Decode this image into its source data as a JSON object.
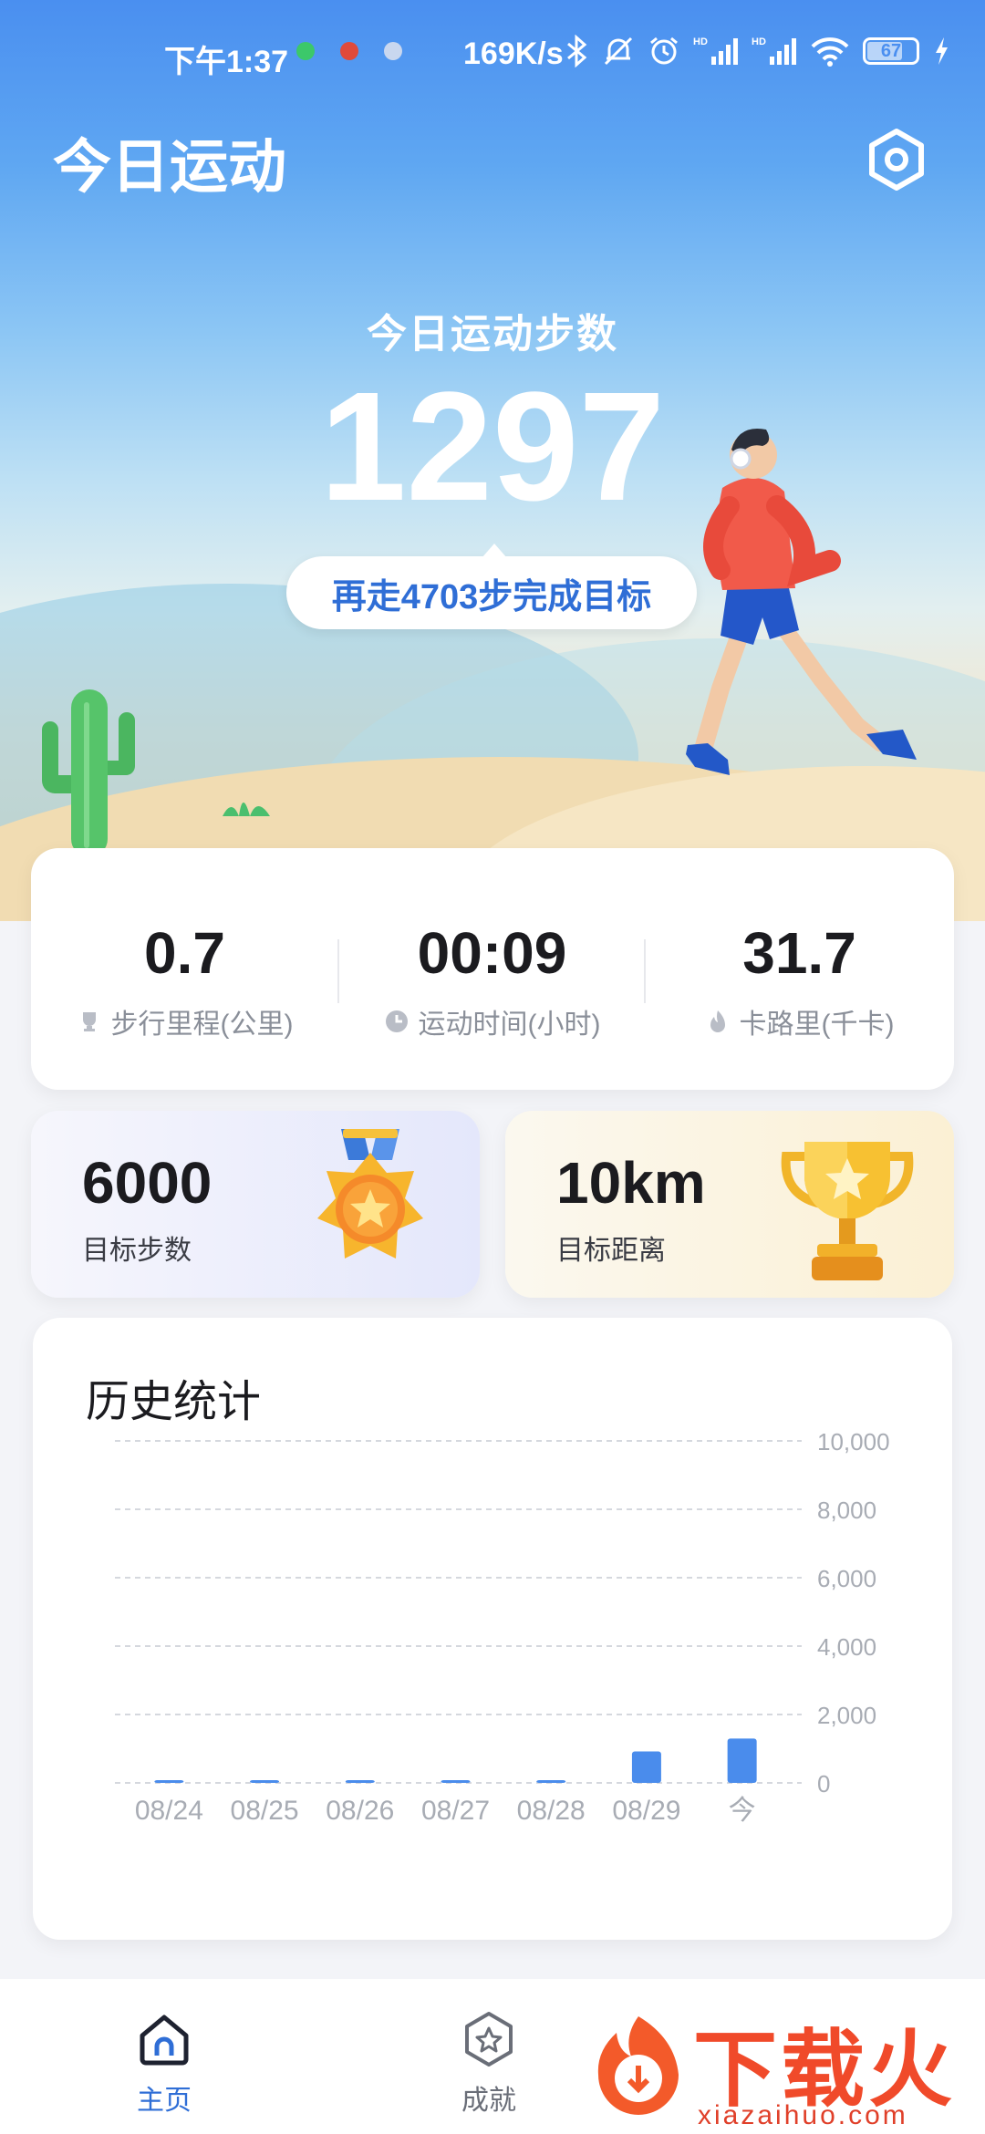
{
  "status_bar": {
    "time": "下午1:37",
    "network_speed": "169K/s",
    "battery": "67",
    "icons": [
      "bluetooth-icon",
      "mute-icon",
      "alarm-icon",
      "signal-icon",
      "signal-icon",
      "wifi-icon",
      "battery-icon",
      "charging-icon"
    ]
  },
  "header": {
    "title": "今日运动",
    "settings_icon": "hexagon-settings-icon"
  },
  "today": {
    "label": "今日运动步数",
    "steps": "1297",
    "goal_hint": "再走4703步完成目标"
  },
  "stats": [
    {
      "value": "0.7",
      "label": "步行里程(公里)",
      "icon": "trophy-icon"
    },
    {
      "value": "00:09",
      "label": "运动时间(小时)",
      "icon": "clock-icon"
    },
    {
      "value": "31.7",
      "label": "卡路里(千卡)",
      "icon": "flame-icon"
    }
  ],
  "goals": {
    "steps": {
      "value": "6000",
      "label": "目标步数"
    },
    "distance": {
      "value": "10km",
      "label": "目标距离"
    }
  },
  "history": {
    "title": "历史统计"
  },
  "chart_data": {
    "type": "bar",
    "title": "历史统计",
    "categories": [
      "08/24",
      "08/25",
      "08/26",
      "08/27",
      "08/28",
      "08/29",
      "今"
    ],
    "values": [
      80,
      80,
      80,
      80,
      80,
      920,
      1297
    ],
    "ylim": [
      0,
      10000
    ],
    "yticks": [
      "10,000",
      "8,000",
      "6,000",
      "4,000",
      "2,000",
      "0"
    ],
    "ytick_values": [
      10000,
      8000,
      6000,
      4000,
      2000,
      0
    ],
    "y_axis_side": "right",
    "grid": true,
    "bar_color": "#4a8cec"
  },
  "nav": {
    "items": [
      {
        "label": "主页",
        "icon": "home-icon",
        "active": true
      },
      {
        "label": "成就",
        "icon": "star-hexagon-icon",
        "active": false
      }
    ]
  },
  "watermark": {
    "text": "下载火",
    "url": "xiazaihuo.com"
  },
  "colors": {
    "accent": "#2f6ed6",
    "hero_top": "#4a8ff0",
    "bar": "#4a8cec"
  }
}
